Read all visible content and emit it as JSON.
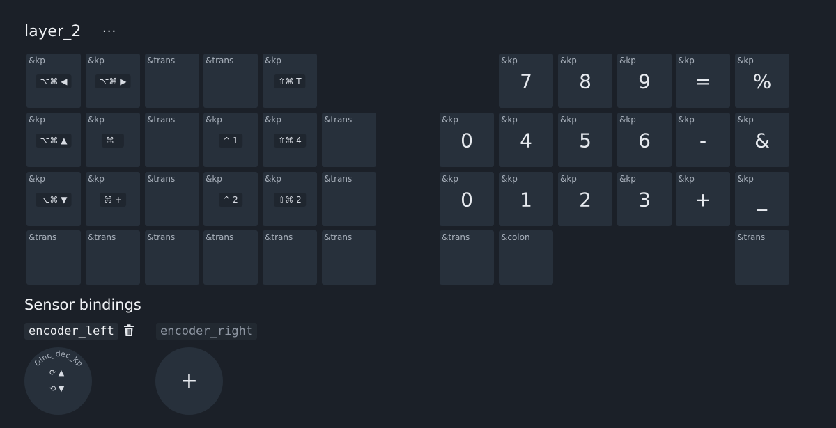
{
  "layer": {
    "name": "layer_2",
    "menu_label": "···"
  },
  "keys": [
    {
      "id": "l-r0-c0",
      "behavior": "&kp",
      "param": "⌥⌘ ◀",
      "style": "pill"
    },
    {
      "id": "l-r0-c1",
      "behavior": "&kp",
      "param": "⌥⌘ ▶",
      "style": "pill"
    },
    {
      "id": "l-r0-c2",
      "behavior": "&trans",
      "param": "",
      "style": "none"
    },
    {
      "id": "l-r0-c3",
      "behavior": "&trans",
      "param": "",
      "style": "none"
    },
    {
      "id": "l-r0-c4",
      "behavior": "&kp",
      "param": "⇧⌘ T",
      "style": "pill"
    },
    {
      "id": "l-r1-c0",
      "behavior": "&kp",
      "param": "⌥⌘ ▲",
      "style": "pill"
    },
    {
      "id": "l-r1-c1",
      "behavior": "&kp",
      "param": "⌘ -",
      "style": "pill"
    },
    {
      "id": "l-r1-c2",
      "behavior": "&trans",
      "param": "",
      "style": "none"
    },
    {
      "id": "l-r1-c3",
      "behavior": "&kp",
      "param": "^ 1",
      "style": "pill"
    },
    {
      "id": "l-r1-c4",
      "behavior": "&kp",
      "param": "⇧⌘ 4",
      "style": "pill"
    },
    {
      "id": "l-r1-c5",
      "behavior": "&trans",
      "param": "",
      "style": "none"
    },
    {
      "id": "l-r2-c0",
      "behavior": "&kp",
      "param": "⌥⌘ ▼",
      "style": "pill"
    },
    {
      "id": "l-r2-c1",
      "behavior": "&kp",
      "param": "⌘ +",
      "style": "pill"
    },
    {
      "id": "l-r2-c2",
      "behavior": "&trans",
      "param": "",
      "style": "none"
    },
    {
      "id": "l-r2-c3",
      "behavior": "&kp",
      "param": "^ 2",
      "style": "pill"
    },
    {
      "id": "l-r2-c4",
      "behavior": "&kp",
      "param": "⇧⌘ 2",
      "style": "pill"
    },
    {
      "id": "l-r2-c5",
      "behavior": "&trans",
      "param": "",
      "style": "none"
    },
    {
      "id": "l-r3-c0",
      "behavior": "&trans",
      "param": "",
      "style": "none"
    },
    {
      "id": "l-r3-c1",
      "behavior": "&trans",
      "param": "",
      "style": "none"
    },
    {
      "id": "l-r3-c2",
      "behavior": "&trans",
      "param": "",
      "style": "none"
    },
    {
      "id": "l-r3-c3",
      "behavior": "&trans",
      "param": "",
      "style": "none"
    },
    {
      "id": "l-r3-c4",
      "behavior": "&trans",
      "param": "",
      "style": "none"
    },
    {
      "id": "l-r3-c5",
      "behavior": "&trans",
      "param": "",
      "style": "none"
    },
    {
      "id": "r-r0-c1",
      "behavior": "&kp",
      "param": "7",
      "style": "big"
    },
    {
      "id": "r-r0-c2",
      "behavior": "&kp",
      "param": "8",
      "style": "big"
    },
    {
      "id": "r-r0-c3",
      "behavior": "&kp",
      "param": "9",
      "style": "big"
    },
    {
      "id": "r-r0-c4",
      "behavior": "&kp",
      "param": "=",
      "style": "big"
    },
    {
      "id": "r-r0-c5",
      "behavior": "&kp",
      "param": "%",
      "style": "big"
    },
    {
      "id": "r-r1-c0",
      "behavior": "&kp",
      "param": "0",
      "style": "big"
    },
    {
      "id": "r-r1-c1",
      "behavior": "&kp",
      "param": "4",
      "style": "big"
    },
    {
      "id": "r-r1-c2",
      "behavior": "&kp",
      "param": "5",
      "style": "big"
    },
    {
      "id": "r-r1-c3",
      "behavior": "&kp",
      "param": "6",
      "style": "big"
    },
    {
      "id": "r-r1-c4",
      "behavior": "&kp",
      "param": "-",
      "style": "big"
    },
    {
      "id": "r-r1-c5",
      "behavior": "&kp",
      "param": "&",
      "style": "big"
    },
    {
      "id": "r-r2-c0",
      "behavior": "&kp",
      "param": "0",
      "style": "big"
    },
    {
      "id": "r-r2-c1",
      "behavior": "&kp",
      "param": "1",
      "style": "big"
    },
    {
      "id": "r-r2-c2",
      "behavior": "&kp",
      "param": "2",
      "style": "big"
    },
    {
      "id": "r-r2-c3",
      "behavior": "&kp",
      "param": "3",
      "style": "big"
    },
    {
      "id": "r-r2-c4",
      "behavior": "&kp",
      "param": "+",
      "style": "big"
    },
    {
      "id": "r-r2-c5",
      "behavior": "&kp",
      "param": "_",
      "style": "big"
    },
    {
      "id": "r-r3-c0",
      "behavior": "&trans",
      "param": "",
      "style": "none"
    },
    {
      "id": "r-r3-c1",
      "behavior": "&colon",
      "param": "",
      "style": "none"
    },
    {
      "id": "r-r3-c5",
      "behavior": "&trans",
      "param": "",
      "style": "none"
    }
  ],
  "sensors": {
    "title": "Sensor bindings",
    "tabs": [
      {
        "label": "encoder_left",
        "active": true
      },
      {
        "label": "encoder_right",
        "active": false
      }
    ],
    "delete_icon": "trash-icon",
    "binding": {
      "behavior": "&inc_dec_kp",
      "cw_label": "⟳ ▲",
      "ccw_label": "⟲ ▼"
    },
    "add_label": "+"
  }
}
